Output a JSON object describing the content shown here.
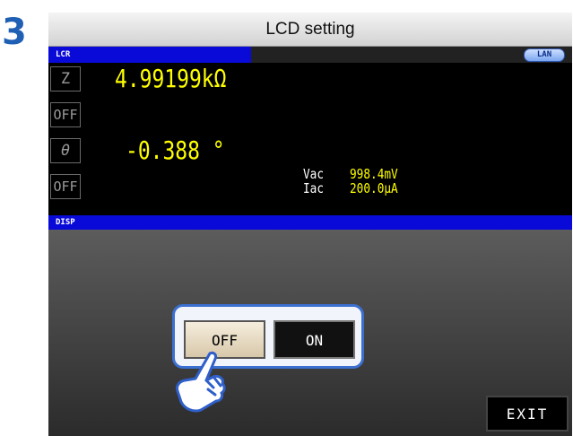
{
  "step": {
    "number": "3"
  },
  "title_bar": {
    "title": "LCD setting"
  },
  "header": {
    "lcr_tab": "LCR",
    "lan_badge": "LAN"
  },
  "measurement": {
    "param1": {
      "label": "Z",
      "value": "4.99199kΩ"
    },
    "param2": {
      "label": "OFF"
    },
    "param3": {
      "label": "θ",
      "value": "-0.388 °"
    },
    "param4": {
      "label": "OFF"
    },
    "monitor": [
      {
        "label": "Vac",
        "value": "998.4mV"
      },
      {
        "label": "Iac",
        "value": "200.0μA"
      }
    ]
  },
  "settings": {
    "section_label": "DISP",
    "off_label": "OFF",
    "on_label": "ON",
    "selected": "OFF"
  },
  "footer": {
    "exit_label": "EXIT"
  },
  "colors": {
    "accent_blue": "#0a0ad8",
    "value_yellow": "#ffff00",
    "step_blue": "#1f5fb4",
    "highlight_outline": "#3b6fd0"
  },
  "icons": {
    "pointer": "hand-pointer-icon"
  }
}
